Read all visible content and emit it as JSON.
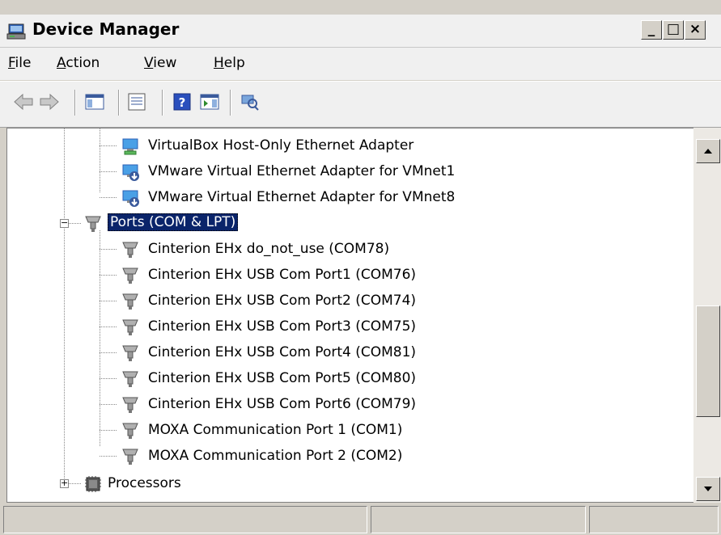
{
  "window": {
    "title": "Device Manager",
    "minimize": "_",
    "maximize": "□",
    "close": "×"
  },
  "menu": [
    {
      "label": "File",
      "accel": "F",
      "rest": "ile"
    },
    {
      "label": "Action",
      "accel": "A",
      "rest": "ction"
    },
    {
      "label": "View",
      "accel": "V",
      "rest": "iew"
    },
    {
      "label": "Help",
      "accel": "H",
      "rest": "elp"
    }
  ],
  "toolbar": {
    "icons": [
      "back-icon",
      "forward-icon",
      "show-hide-console-tree-icon",
      "properties-icon",
      "help-icon",
      "show-hide-action-pane-icon",
      "scan-hardware-changes-icon"
    ]
  },
  "tree": {
    "network_items": [
      "VirtualBox Host-Only Ethernet Adapter",
      "VMware Virtual Ethernet Adapter for VMnet1",
      "VMware Virtual Ethernet Adapter for VMnet8"
    ],
    "ports_category": "Ports (COM & LPT)",
    "ports": [
      "Cinterion EHx do_not_use (COM78)",
      "Cinterion EHx USB Com Port1 (COM76)",
      "Cinterion EHx USB Com Port2 (COM74)",
      "Cinterion EHx USB Com Port3 (COM75)",
      "Cinterion EHx USB Com Port4 (COM81)",
      "Cinterion EHx USB Com Port5 (COM80)",
      "Cinterion EHx USB Com Port6 (COM79)",
      "MOXA Communication Port 1 (COM1)",
      "MOXA Communication Port 2 (COM2)"
    ],
    "processors_category": "Processors",
    "expand_minus": "−",
    "expand_plus": "+"
  },
  "statusbar": {
    "pane1": "",
    "pane2": "",
    "pane3": ""
  },
  "colors": {
    "selection": "#0a246a",
    "chrome": "#d4d0c8",
    "panel": "#f0f0f0"
  }
}
